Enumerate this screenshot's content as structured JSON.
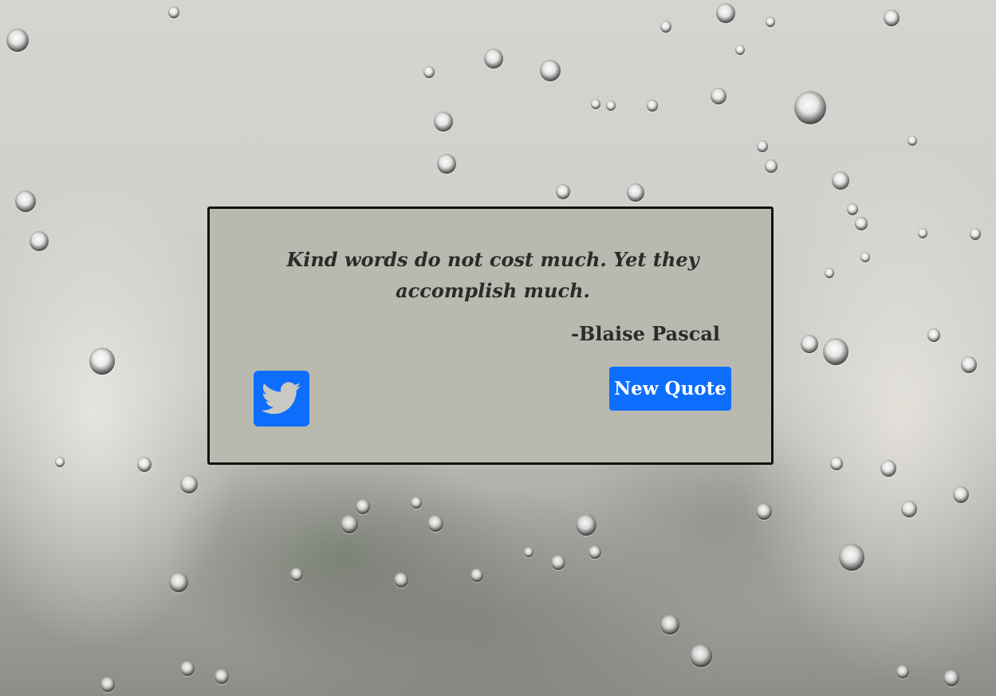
{
  "quote": {
    "text": "Kind words do not cost much. Yet they accomplish much.",
    "author": "-Blaise Pascal"
  },
  "actions": {
    "tweet_icon": "twitter-icon",
    "new_quote_label": "New Quote"
  },
  "colors": {
    "card_background": "#b9b9b0",
    "card_border": "#111111",
    "button_blue": "#0d6efd",
    "text": "#2b2b2b"
  }
}
